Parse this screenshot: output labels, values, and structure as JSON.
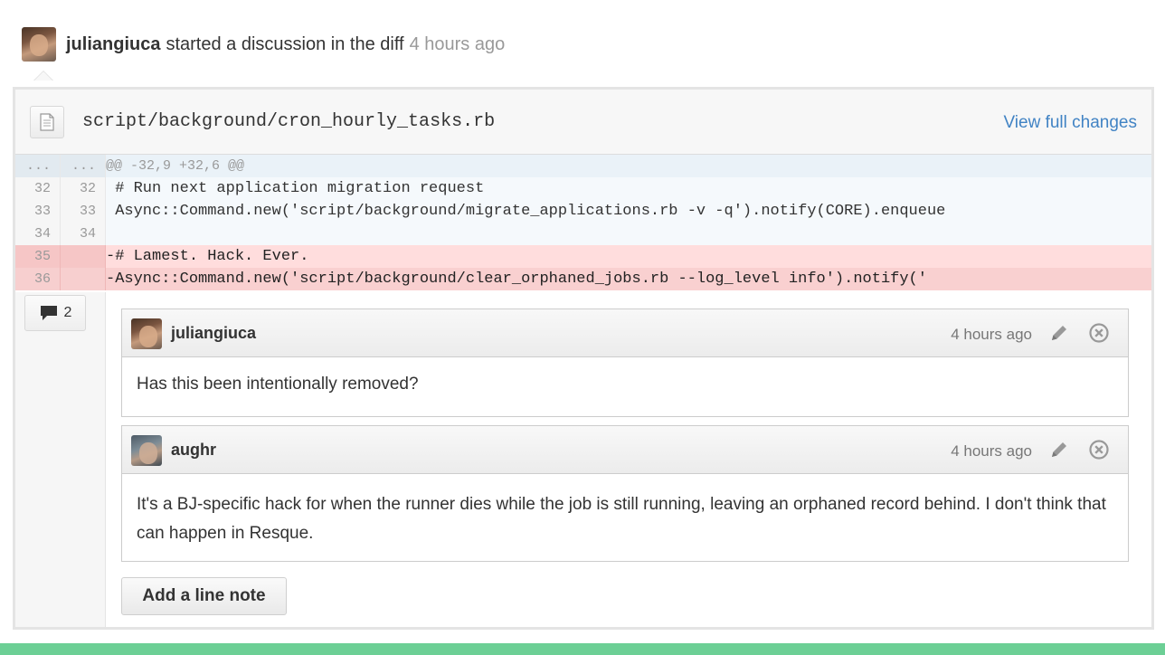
{
  "header": {
    "username": "juliangiuca",
    "action": "started a discussion in the diff",
    "time": "4 hours ago"
  },
  "file": {
    "path": "script/background/cron_hourly_tasks.rb",
    "view_full_changes": "View full changes",
    "icon": "file-icon"
  },
  "diff": {
    "hunk": {
      "old": "...",
      "new": "...",
      "text": "@@ -32,9 +32,6 @@"
    },
    "lines": [
      {
        "old": "32",
        "new": "32",
        "text": " # Run next application migration request"
      },
      {
        "old": "33",
        "new": "33",
        "text": " Async::Command.new('script/background/migrate_applications.rb -v -q').notify(CORE).enqueue"
      },
      {
        "old": "34",
        "new": "34",
        "text": " "
      },
      {
        "old": "35",
        "new": "",
        "text": "-# Lamest. Hack. Ever."
      },
      {
        "old": "36",
        "new": "",
        "text": "-Async::Command.new('script/background/clear_orphaned_jobs.rb --log_level info').notify('"
      }
    ]
  },
  "comment_count": "2",
  "comments": [
    {
      "author": "juliangiuca",
      "time": "4 hours ago",
      "body": "Has this been intentionally removed?"
    },
    {
      "author": "aughr",
      "time": "4 hours ago",
      "body": "It's a BJ-specific hack for when the runner dies while the job is still running, leaving an orphaned record behind. I don't think that can happen in Resque."
    }
  ],
  "add_line_note": "Add a line note",
  "colors": {
    "link": "#4183c4",
    "deleted_line_bg": "#ffdddd",
    "footer_bar": "#6ccf95"
  }
}
